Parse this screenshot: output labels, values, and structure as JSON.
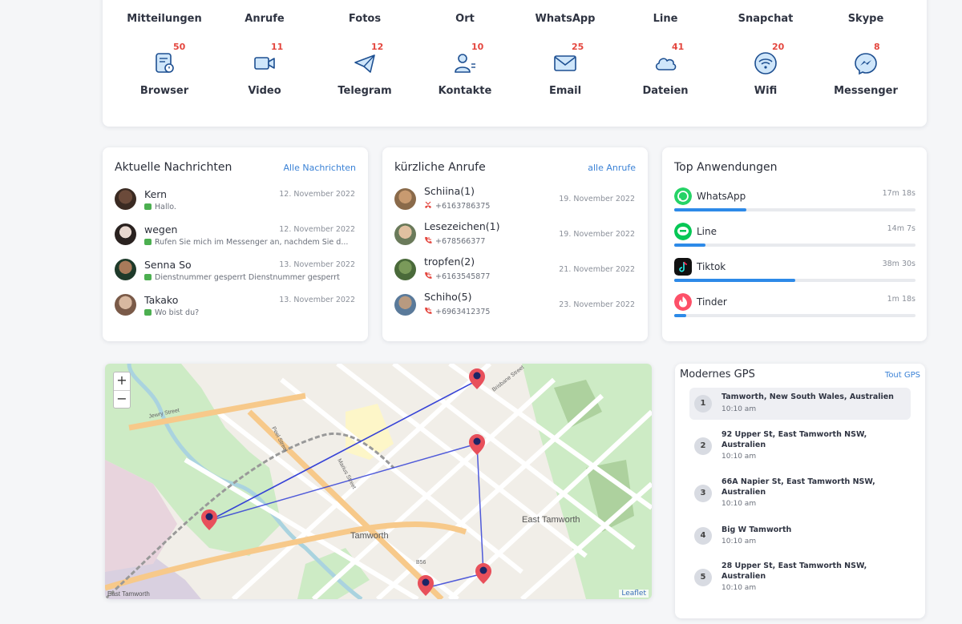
{
  "top_row_labels": [
    "Mitteilungen",
    "Anrufe",
    "Fotos",
    "Ort",
    "WhatsApp",
    "Line",
    "Snapchat",
    "Skype"
  ],
  "categories": [
    {
      "label": "Browser",
      "count": "50",
      "icon": "browser-icon"
    },
    {
      "label": "Video",
      "count": "11",
      "icon": "video-icon"
    },
    {
      "label": "Telegram",
      "count": "12",
      "icon": "telegram-icon"
    },
    {
      "label": "Kontakte",
      "count": "10",
      "icon": "contacts-icon"
    },
    {
      "label": "Email",
      "count": "25",
      "icon": "email-icon"
    },
    {
      "label": "Dateien",
      "count": "41",
      "icon": "cloud-files-icon"
    },
    {
      "label": "Wifi",
      "count": "20",
      "icon": "wifi-icon"
    },
    {
      "label": "Messenger",
      "count": "8",
      "icon": "messenger-icon"
    }
  ],
  "messages": {
    "title": "Aktuelle Nachrichten",
    "link": "Alle Nachrichten",
    "items": [
      {
        "name": "Kern",
        "date": "12. November 2022",
        "text": "Hallo."
      },
      {
        "name": "wegen",
        "date": "12. November 2022",
        "text": "Rufen Sie mich im Messenger an, nachdem Sie d..."
      },
      {
        "name": "Senna So",
        "date": "13. November 2022",
        "text": "Dienstnummer gesperrt Dienstnummer gesperrt"
      },
      {
        "name": "Takako",
        "date": "13. November 2022",
        "text": "Wo bist du?"
      }
    ]
  },
  "calls": {
    "title": "kürzliche Anrufe",
    "link": "alle Anrufe",
    "items": [
      {
        "name": "Schiina(1)",
        "number": "+6163786375",
        "date": "19. November 2022",
        "type": "missed"
      },
      {
        "name": "Lesezeichen(1)",
        "number": "+678566377",
        "date": "19. November 2022",
        "type": "incoming"
      },
      {
        "name": "tropfen(2)",
        "number": "+6163545877",
        "date": "21. November 2022",
        "type": "incoming"
      },
      {
        "name": "Schiho(5)",
        "number": "+6963412375",
        "date": "23. November 2022",
        "type": "incoming"
      }
    ]
  },
  "apps": {
    "title": "Top Anwendungen",
    "items": [
      {
        "name": "WhatsApp",
        "time": "17m 18s",
        "usage": 0.3,
        "color": "#25d366"
      },
      {
        "name": "Line",
        "time": "14m 7s",
        "usage": 0.13,
        "color": "#06c755"
      },
      {
        "name": "Tiktok",
        "time": "38m 30s",
        "usage": 0.5,
        "color": "#111111"
      },
      {
        "name": "Tinder",
        "time": "1m 18s",
        "usage": 0.05,
        "color": "#fd5068"
      }
    ]
  },
  "map": {
    "zoom_in": "+",
    "zoom_out": "−",
    "attribution": "Leaflet",
    "labels": [
      "Tamworth",
      "East Tamworth",
      "East Tamworth",
      "Peel Street",
      "Marius Street",
      "Brisbane Street",
      "Jewry Street",
      "B56"
    ]
  },
  "gps": {
    "title": "Modernes GPS",
    "link": "Tout GPS",
    "items": [
      {
        "num": "1",
        "address": "Tamworth, New South Wales, Australien",
        "time": "10:10 am"
      },
      {
        "num": "2",
        "address": "92 Upper St, East Tamworth NSW, Australien",
        "time": "10:10 am"
      },
      {
        "num": "3",
        "address": "66A Napier St, East Tamworth NSW, Australien",
        "time": "10:10 am"
      },
      {
        "num": "4",
        "address": "Big W Tamworth",
        "time": "10:10 am"
      },
      {
        "num": "5",
        "address": "28 Upper St, East Tamworth NSW, Australien",
        "time": "10:10 am"
      }
    ]
  },
  "colors": {
    "accent": "#3b82d6",
    "badge_red": "#e4473f",
    "bar_blue": "#2d8ae8",
    "route_blue": "#3340d6",
    "pin_red": "#e8505b"
  }
}
